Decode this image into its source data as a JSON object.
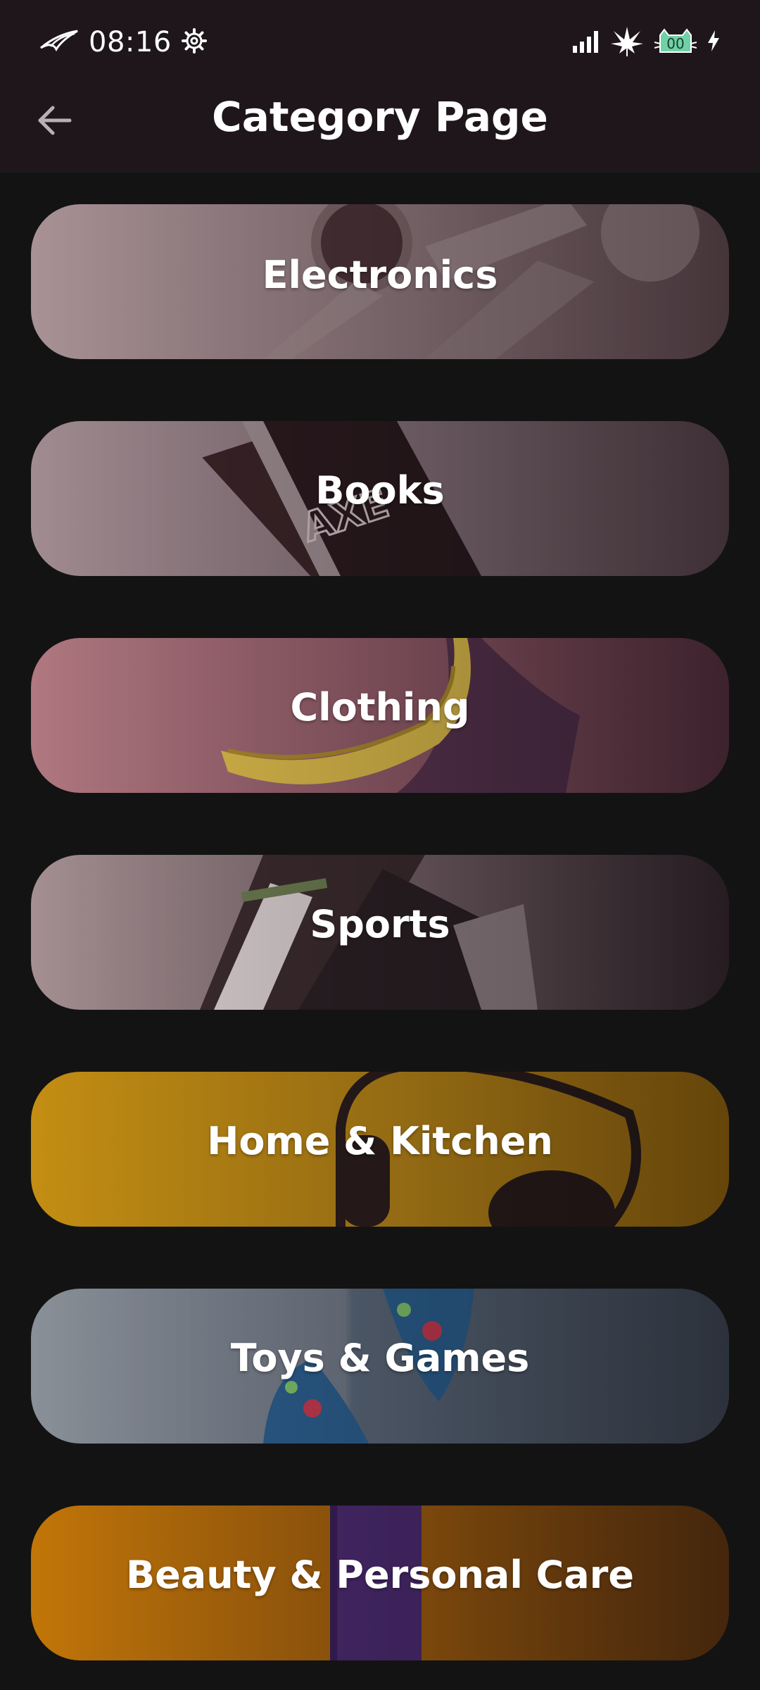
{
  "status_bar": {
    "time": "08:16",
    "left_icons": [
      "rog-logo-icon",
      "settings-gear-icon"
    ],
    "right_icons": [
      "signal-bars-icon",
      "leaf-icon",
      "battery-cat-icon",
      "charging-bolt-icon"
    ],
    "battery_text": "00"
  },
  "app_bar": {
    "title": "Category Page",
    "back_icon": "arrow-left-icon"
  },
  "categories": [
    {
      "label": "Electronics",
      "image": "wristwatch",
      "colors": [
        "#a89296",
        "#6a5158"
      ]
    },
    {
      "label": "Books",
      "image": "axe-deodorant-can",
      "colors": [
        "#a08c90",
        "#5f4a52"
      ]
    },
    {
      "label": "Clothing",
      "image": "banana",
      "colors": [
        "#b07880",
        "#5d3545"
      ]
    },
    {
      "label": "Sports",
      "image": "sneakers",
      "colors": [
        "#a48f92",
        "#3a2b33"
      ]
    },
    {
      "label": "Home & Kitchen",
      "image": "headphones",
      "colors": [
        "#c38e12",
        "#9b6a10"
      ]
    },
    {
      "label": "Toys & Games",
      "image": "floral-shoes",
      "colors": [
        "#8a9098",
        "#444d5c"
      ]
    },
    {
      "label": "Beauty & Personal Care",
      "image": "purple-bottle",
      "colors": [
        "#c27608",
        "#6a3a13"
      ]
    }
  ]
}
